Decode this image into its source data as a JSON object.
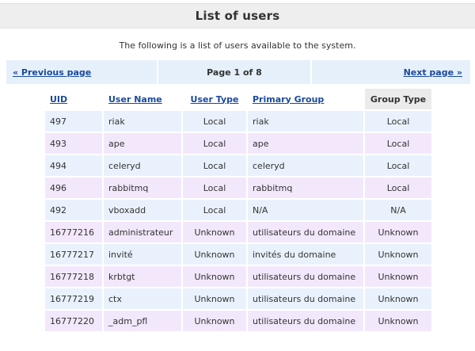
{
  "page": {
    "title": "List of users",
    "intro": "The following is a list of users available to the system."
  },
  "pager": {
    "prev_label": "« Previous page",
    "page_label": "Page 1 of 8",
    "next_label": "Next page »"
  },
  "table": {
    "headers": {
      "uid": "UID",
      "user_name": "User Name",
      "user_type": "User Type",
      "primary_group": "Primary Group",
      "group_type": "Group Type"
    },
    "rows": [
      {
        "uid": "497",
        "user_name": "riak",
        "user_type": "Local",
        "primary_group": "riak",
        "group_type": "Local"
      },
      {
        "uid": "493",
        "user_name": "ape",
        "user_type": "Local",
        "primary_group": "ape",
        "group_type": "Local"
      },
      {
        "uid": "494",
        "user_name": "celeryd",
        "user_type": "Local",
        "primary_group": "celeryd",
        "group_type": "Local"
      },
      {
        "uid": "496",
        "user_name": "rabbitmq",
        "user_type": "Local",
        "primary_group": "rabbitmq",
        "group_type": "Local"
      },
      {
        "uid": "492",
        "user_name": "vboxadd",
        "user_type": "Local",
        "primary_group": "N/A",
        "group_type": "N/A"
      },
      {
        "uid": "16777216",
        "user_name": "administrateur",
        "user_type": "Unknown",
        "primary_group": "utilisateurs du domaine",
        "group_type": "Unknown"
      },
      {
        "uid": "16777217",
        "user_name": "invité",
        "user_type": "Unknown",
        "primary_group": "invités du domaine",
        "group_type": "Unknown"
      },
      {
        "uid": "16777218",
        "user_name": "krbtgt",
        "user_type": "Unknown",
        "primary_group": "utilisateurs du domaine",
        "group_type": "Unknown"
      },
      {
        "uid": "16777219",
        "user_name": "ctx",
        "user_type": "Unknown",
        "primary_group": "utilisateurs du domaine",
        "group_type": "Unknown"
      },
      {
        "uid": "16777220",
        "user_name": "_adm_pfl",
        "user_type": "Unknown",
        "primary_group": "utilisateurs du domaine",
        "group_type": "Unknown"
      }
    ]
  },
  "colors": {
    "link": "#1a4a9c",
    "row_odd": "#e9f2fc",
    "row_even": "#f3e8fb",
    "pager_bg": "#e6f0fb",
    "title_bg": "#eeeeee"
  }
}
